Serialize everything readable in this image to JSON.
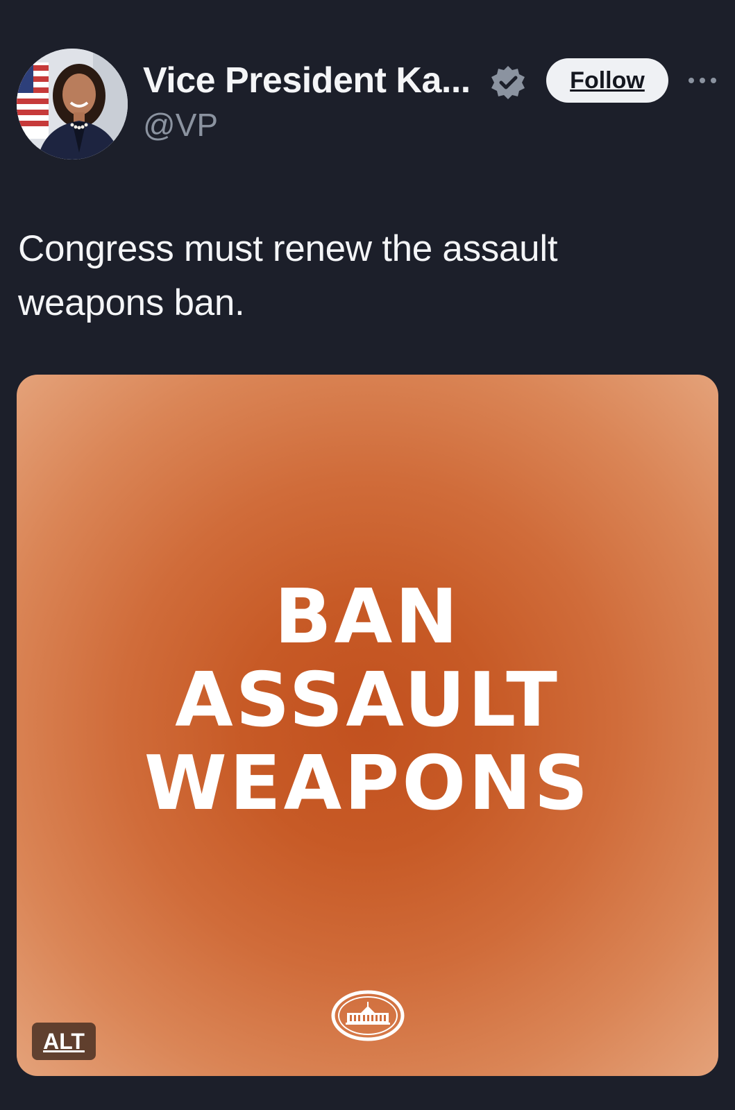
{
  "account": {
    "display_name": "Vice President Ka...",
    "handle": "@VP",
    "verified": true,
    "verified_icon": "verified-badge-icon",
    "avatar_icon": "profile-photo"
  },
  "actions": {
    "follow_label": "Follow",
    "more_icon": "more-options-icon"
  },
  "tweet": {
    "text": "Congress must renew the assault weapons ban."
  },
  "media": {
    "headline_lines": [
      "BAN",
      "ASSAULT",
      "WEAPONS"
    ],
    "logo": "white-house-logo",
    "alt_label": "ALT",
    "background_color": "#c2511f"
  },
  "colors": {
    "page_background": "#1c1f2a",
    "secondary_text": "#8b93a0",
    "follow_button_bg": "#eff1f4",
    "verified_badge": "#8b93a0"
  }
}
